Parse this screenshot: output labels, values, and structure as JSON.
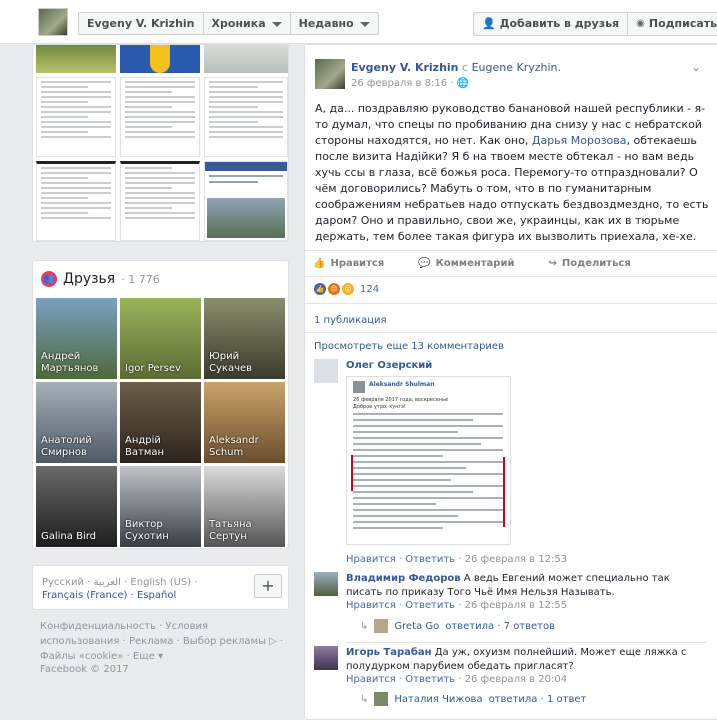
{
  "header": {
    "profile_name": "Evgeny V. Krizhin",
    "tab_label": "Хроника",
    "sort_label": "Недавно",
    "add_friend": "Добавить в друзья",
    "subscribe": "Подписаться"
  },
  "friends": {
    "title": "Друзья",
    "count": "· 1 776",
    "list": [
      {
        "name": "Андрей Мартьянов"
      },
      {
        "name": "Igor Persev"
      },
      {
        "name": "Юрий Сукачев"
      },
      {
        "name": "Анатолий Смирнов"
      },
      {
        "name": "Андрій Ватман"
      },
      {
        "name": "Aleksandr Schum"
      },
      {
        "name": "Galina Bird"
      },
      {
        "name": "Виктор Сухотин"
      },
      {
        "name": "Татьяна Сертун"
      }
    ]
  },
  "languages": {
    "line1": "Русский · العربية · English (US) ·",
    "line2": "Français (France) · Español"
  },
  "footer": {
    "links": "Конфиденциальность · Условия использования · Реклама · Выбор рекламы ▷ · Файлы «cookie» · Еще ▾",
    "copyright": "Facebook © 2017"
  },
  "post": {
    "author": "Evgeny V. Krizhin",
    "with_prefix": "с",
    "with_name": "Eugene Kryzhin.",
    "time": "26 февраля в 8:16 ·",
    "text_before": "А, да... поздравляю руководство банановой нашей республики - я-то думал, что спецы по пробиванию дна снизу у нас с небратской стороны находятся, но нет. Как оно, ",
    "mention": "Дарья Морозова",
    "text_after": ", обтекаешь после визита Надійки? Я б на твоем месте обтекал - но вам ведь хучь ссы в глаза, всё божья роса. Перемогу-то отпраздновали? О чём договорились? Мабуть о том, что в по гуманитарным соображениям небратьев надо отпускать бездвоздмездно, то есть даром? Оно и правильно, свои же, украинцы, как их в тюрьме держать, тем более такая фигура их вызволить приехала, хе-хе.",
    "like": "Нравится",
    "comment": "Комментарий",
    "share": "Поделиться",
    "reaction_count": "124",
    "shares": "1 публикация",
    "more_comments": "Просмотреть еще 13 комментариев"
  },
  "comments": [
    {
      "author": "Олег Озерский",
      "text": "",
      "like": "Нравится",
      "reply": "Ответить",
      "time": "26 февраля в 12:53"
    },
    {
      "author": "Владимир Федоров",
      "text": "А ведь Евгений может специально так писать по приказу Того Чьё Имя Нельзя Называть.",
      "like": "Нравится",
      "reply": "Ответить",
      "time": "26 февраля в 12:55",
      "replies_author": "Greta Go",
      "replies_suffix": "ответила · 7 ответов"
    },
    {
      "author": "Игорь Тарабан",
      "text": "Да уж, охуизм полнейший. Может еще ляжка с полудурком парубием обедать пригласят?",
      "like": "Нравится",
      "reply": "Ответить",
      "time": "26 февраля в 20:04",
      "replies_author": "Наталия Чижова",
      "replies_suffix": "ответила · 1 ответ"
    }
  ],
  "embedded_screenshot": {
    "name": "Aleksandr Shulman",
    "date": "26 февраля 2017 года, воскресенье",
    "greeting": "Доброе утро, кунгэ!"
  }
}
